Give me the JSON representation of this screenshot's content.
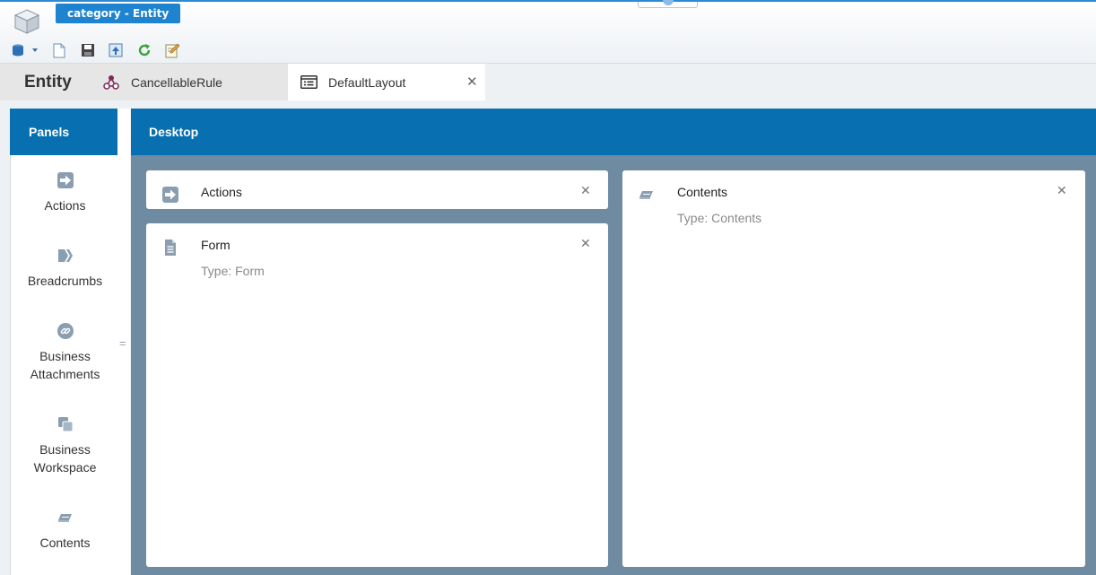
{
  "window": {
    "title": "category - Entity"
  },
  "toolbar": {
    "buttons": [
      "db-dropdown-icon",
      "new-document-icon",
      "save-icon",
      "import-icon",
      "refresh-icon",
      "edit-icon"
    ]
  },
  "tabs": {
    "entity_label": "Entity",
    "rule_label": "CancellableRule",
    "layout_label": "DefaultLayout",
    "close_glyph": "✕"
  },
  "panels": {
    "header": "Panels",
    "items": [
      {
        "label": "Actions",
        "icon": "arrow-right-icon"
      },
      {
        "label": "Breadcrumbs",
        "icon": "breadcrumbs-icon"
      },
      {
        "label": "Business Attachments",
        "icon": "attachment-icon"
      },
      {
        "label": "Business Workspace",
        "icon": "workspace-icon"
      },
      {
        "label": "Contents",
        "icon": "contents-icon"
      }
    ],
    "splitter_glyph": "="
  },
  "desktop": {
    "header": "Desktop",
    "cards": {
      "actions": {
        "title": "Actions",
        "type": ""
      },
      "form": {
        "title": "Form",
        "type": "Type: Form"
      },
      "contents": {
        "title": "Contents",
        "type": "Type: Contents"
      }
    },
    "close_glyph": "✕",
    "split_h_glyph": "II",
    "split_v_glyph": "="
  },
  "colors": {
    "accent": "#0870b0",
    "title_pill": "#1f84cf",
    "desktop_bg": "#6e8ba1"
  }
}
